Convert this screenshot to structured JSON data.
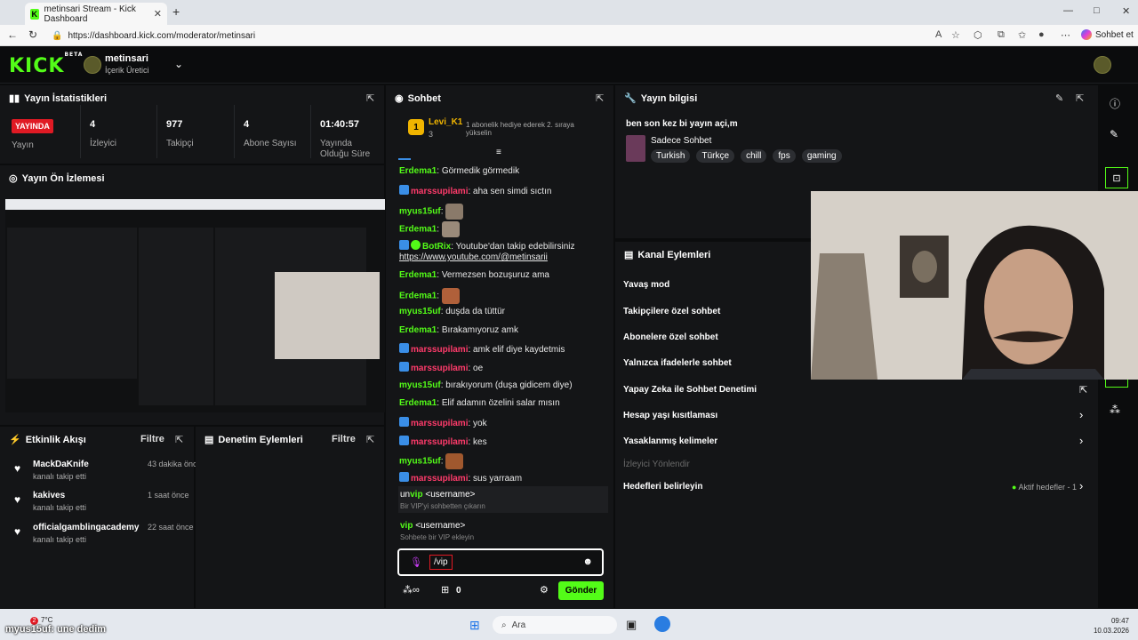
{
  "browser": {
    "tab_title": "metinsari Stream - Kick Dashboard",
    "url": "https://dashboard.kick.com/moderator/metinsari",
    "copilot_label": "Sohbet et"
  },
  "header": {
    "logo": "KICK",
    "logo_beta": "BETA",
    "channel_name": "metinsari",
    "channel_role": "İçerik Üretici"
  },
  "stats": {
    "title": "Yayın İstatistikleri",
    "live_badge": "YAYINDA",
    "items": [
      {
        "value": "",
        "label": "Yayın"
      },
      {
        "value": "4",
        "label": "İzleyici"
      },
      {
        "value": "977",
        "label": "Takipçi"
      },
      {
        "value": "4",
        "label": "Abone Sayısı"
      },
      {
        "value": "01:40:57",
        "label": "Yayında Olduğu Süre"
      }
    ]
  },
  "preview": {
    "title": "Yayın Ön İzlemesi"
  },
  "activity": {
    "title": "Etkinlik Akışı",
    "filter": "Filtre",
    "items": [
      {
        "name": "MackDaKnife",
        "sub": "kanalı takip etti",
        "time": "43 dakika önce"
      },
      {
        "name": "kakives",
        "sub": "kanalı takip etti",
        "time": "1 saat önce"
      },
      {
        "name": "officialgamblingacademy",
        "sub": "kanalı takip etti",
        "time": "22 saat önce"
      }
    ]
  },
  "moderation": {
    "title": "Denetim Eylemleri",
    "filter": "Filtre"
  },
  "chat": {
    "title": "Sohbet",
    "pinned_user": "Levi_K1",
    "pinned_rank": "1",
    "pinned_count": "3",
    "pinned_msg": "1 abonelik hediye ederek 2. sıraya yükselin",
    "messages": [
      {
        "user": "Erdema1",
        "text": "Görmedik görmedik",
        "style": "green",
        "badge": false
      },
      {
        "user": "marssupilami",
        "text": "aha sen simdi sıctın",
        "style": "pink",
        "badge": true
      },
      {
        "user": "myus15uf",
        "text": "",
        "style": "green",
        "badge": false,
        "emote": "#8a7a6a"
      },
      {
        "user": "Erdema1",
        "text": "",
        "style": "green",
        "badge": false,
        "emote": "#9a8a7a"
      },
      {
        "user": "BotRix",
        "text": "Youtube'dan takip edebilirsiniz",
        "style": "green",
        "badge": true
      },
      {
        "user": "",
        "text": "https://www.youtube.com/@metinsarii",
        "style": "link",
        "badge": false
      },
      {
        "user": "Erdema1",
        "text": "Vermezsen bozuşuruz ama",
        "style": "green",
        "badge": false
      },
      {
        "user": "Erdema1",
        "text": "",
        "style": "green",
        "badge": false,
        "emote": "#b0603a"
      },
      {
        "user": "myus15uf",
        "text": "duşda da tüttür",
        "style": "green",
        "badge": false
      },
      {
        "user": "Erdema1",
        "text": "Bırakamıyoruz amk",
        "style": "green",
        "badge": false
      },
      {
        "user": "marssupilami",
        "text": "amk elif diye kaydetmis",
        "style": "pink",
        "badge": true
      },
      {
        "user": "marssupilami",
        "text": "oe",
        "style": "pink",
        "badge": true
      },
      {
        "user": "myus15uf",
        "text": "bırakıyorum (duşa gidicem diye)",
        "style": "green",
        "badge": false
      },
      {
        "user": "Erdema1",
        "text": "Elif adamın özelini salar mısın",
        "style": "green",
        "badge": false
      },
      {
        "user": "marssupilami",
        "text": "yok",
        "style": "pink",
        "badge": true
      },
      {
        "user": "marssupilami",
        "text": "kes",
        "style": "pink",
        "badge": true
      },
      {
        "user": "myus15uf",
        "text": "",
        "style": "green",
        "badge": false,
        "emote": "#a0582e"
      },
      {
        "user": "marssupilami",
        "text": "sus yarraam",
        "style": "pink",
        "badge": true
      }
    ],
    "commands": [
      {
        "cmd_prefix": "un",
        "cmd_match": "vip",
        "cmd_rest": " <username>",
        "desc": "Bir VIP'yi sohbetten çıkarın"
      },
      {
        "cmd_prefix": "",
        "cmd_match": "vip",
        "cmd_rest": " <username>",
        "desc": "Sohbete bir VIP ekleyin"
      }
    ],
    "input_value": "/vip",
    "points": "0",
    "send_label": "Gönder"
  },
  "stream_info": {
    "title": "Yayın bilgisi",
    "stream_title": "ben son kez bi yayın açi,m",
    "category": "Sadece Sohbet",
    "tags": [
      "Turkish",
      "Türkçe",
      "chill",
      "fps",
      "gaming"
    ]
  },
  "channel_actions": {
    "title": "Kanal Eylemleri",
    "items": [
      {
        "label": "Yavaş mod",
        "disabled": false
      },
      {
        "label": "Takipçilere özel sohbet",
        "disabled": false
      },
      {
        "label": "Abonelere özel sohbet",
        "disabled": false
      },
      {
        "label": "Yalnızca ifadelerle sohbet",
        "disabled": false
      },
      {
        "label": "Yapay Zeka ile Sohbet Denetimi",
        "disabled": false
      },
      {
        "label": "Hesap yaşı kısıtlaması",
        "disabled": false
      },
      {
        "label": "Yasaklanmış kelimeler",
        "disabled": false
      },
      {
        "label": "İzleyici Yönlendir",
        "disabled": true
      },
      {
        "label": "Hedefleri belirleyin",
        "disabled": false
      }
    ],
    "goals_status": "Aktif hedefler - 1"
  },
  "taskbar": {
    "search_label": "Ara",
    "time": "09:47",
    "date": "10.03.2026",
    "weather": "7°C",
    "overlay_text": "myus15uf: une dedim"
  },
  "colors": {
    "brand": "#53fc18",
    "live": "#e01a24",
    "mod_name": "#ff3b6b"
  }
}
